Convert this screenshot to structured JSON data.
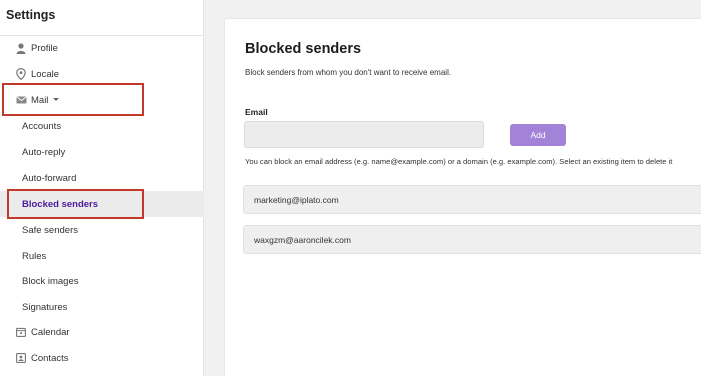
{
  "sidebar": {
    "title": "Settings",
    "items": [
      {
        "label": "Profile",
        "icon": "person-icon"
      },
      {
        "label": "Locale",
        "icon": "location-pin-icon"
      },
      {
        "label": "Mail",
        "icon": "envelope-icon",
        "expanded": true
      },
      {
        "label": "Accounts"
      },
      {
        "label": "Auto-reply"
      },
      {
        "label": "Auto-forward"
      },
      {
        "label": "Blocked senders",
        "active": true
      },
      {
        "label": "Safe senders"
      },
      {
        "label": "Rules"
      },
      {
        "label": "Block images"
      },
      {
        "label": "Signatures"
      },
      {
        "label": "Calendar",
        "icon": "calendar-icon"
      },
      {
        "label": "Contacts",
        "icon": "contacts-icon"
      }
    ]
  },
  "main": {
    "title": "Blocked senders",
    "subtitle": "Block senders from whom you don't want to receive email.",
    "email_label": "Email",
    "email_value": "",
    "add_label": "Add",
    "hint": "You can block an email address (e.g. name@example.com) or a domain (e.g. example.com). Select an existing item to delete it",
    "blocked": [
      {
        "address": "marketing@iplato.com"
      },
      {
        "address": "waxgzm@aaroncilek.com"
      }
    ]
  },
  "colors": {
    "accent": "#4b1a9e",
    "button": "#a283d8",
    "highlight": "#c0392b"
  }
}
